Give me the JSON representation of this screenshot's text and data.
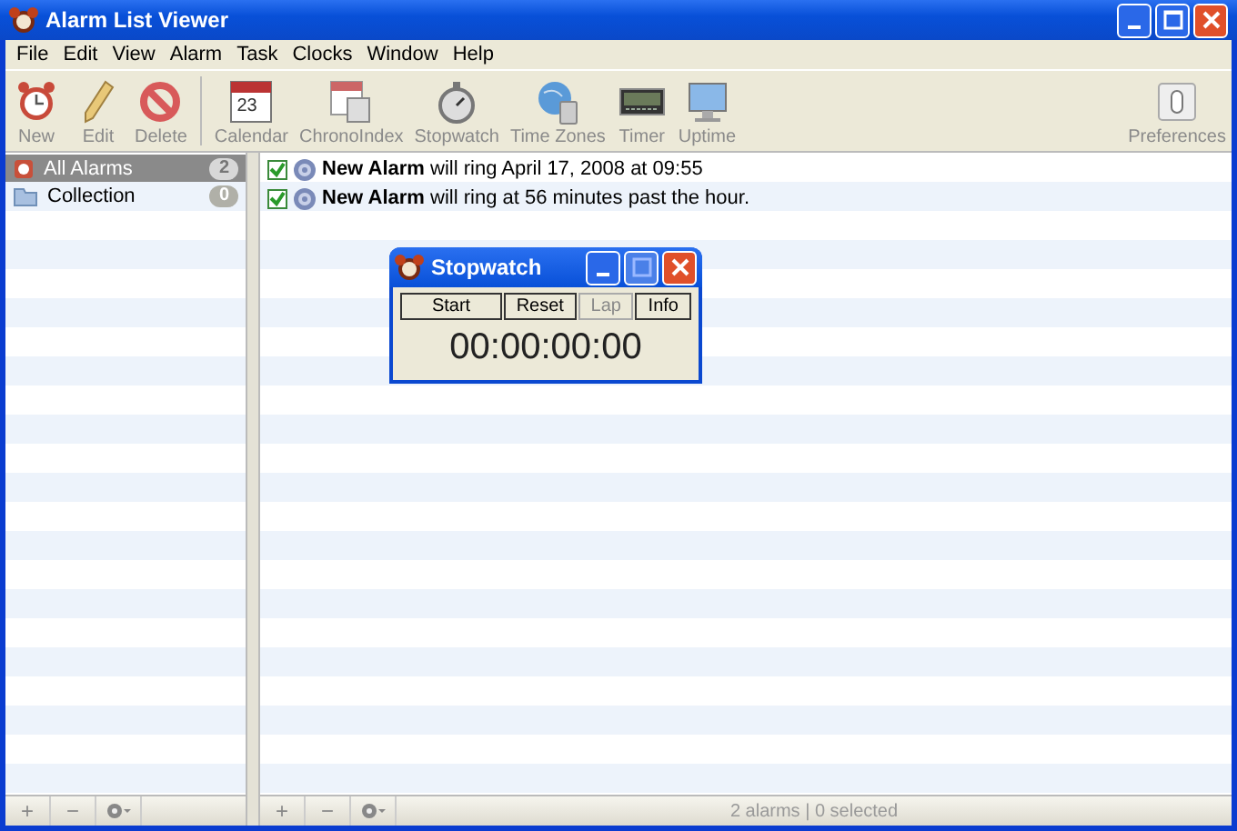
{
  "window": {
    "title": "Alarm List Viewer"
  },
  "menu": [
    "File",
    "Edit",
    "View",
    "Alarm",
    "Task",
    "Clocks",
    "Window",
    "Help"
  ],
  "toolbar": {
    "items": [
      {
        "label": "New"
      },
      {
        "label": "Edit"
      },
      {
        "label": "Delete"
      },
      {
        "label": "Calendar",
        "icon_text": "23"
      },
      {
        "label": "ChronoIndex"
      },
      {
        "label": "Stopwatch"
      },
      {
        "label": "Time Zones"
      },
      {
        "label": "Timer"
      },
      {
        "label": "Uptime"
      }
    ],
    "right_items": [
      {
        "label": "Preferences"
      }
    ]
  },
  "sidebar": {
    "items": [
      {
        "label": "All Alarms",
        "count": "2",
        "selected": true
      },
      {
        "label": "Collection",
        "count": "0",
        "selected": false
      }
    ],
    "footer": [
      "+",
      "−"
    ]
  },
  "alarms": [
    {
      "name": "New Alarm",
      "text": "will ring April 17, 2008 at 09:55",
      "checked": true
    },
    {
      "name": "New Alarm",
      "text": "will ring at 56 minutes past the hour.",
      "checked": true
    }
  ],
  "main_footer": {
    "buttons": [
      "+",
      "−"
    ],
    "status": "2 alarms | 0 selected"
  },
  "stopwatch": {
    "title": "Stopwatch",
    "buttons": [
      {
        "label": "Start",
        "disabled": false
      },
      {
        "label": "Reset",
        "disabled": false
      },
      {
        "label": "Lap",
        "disabled": true
      },
      {
        "label": "Info",
        "disabled": false
      }
    ],
    "time": "00:00:00:00"
  }
}
